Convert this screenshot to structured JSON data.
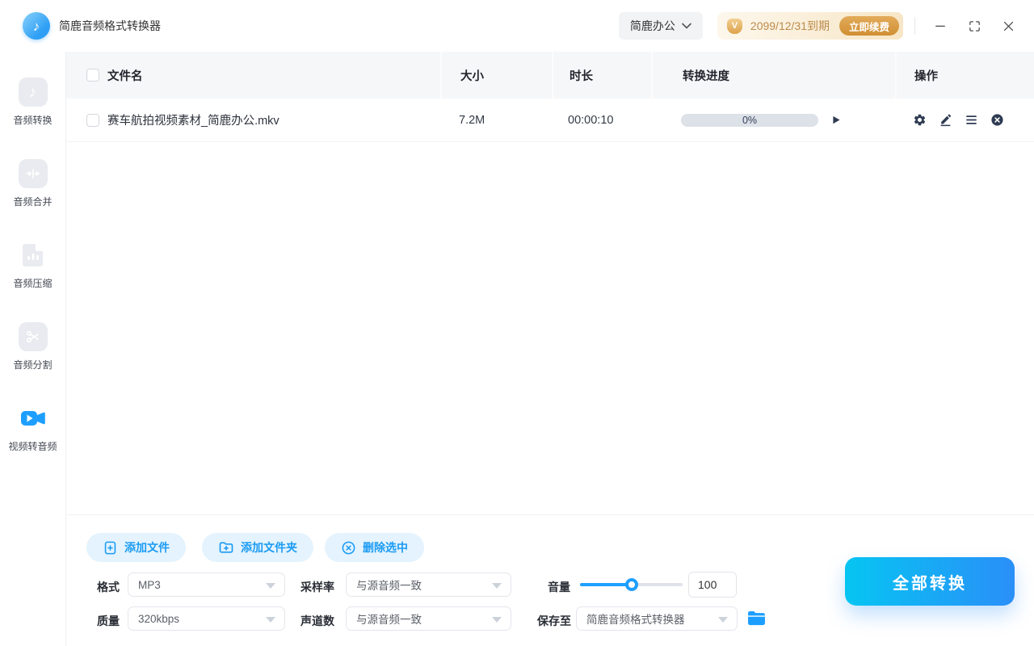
{
  "app": {
    "title": "简鹿音频格式转换器"
  },
  "topbar": {
    "account_dropdown_label": "简鹿办公",
    "vip_badge": "V",
    "license_expiry": "2099/12/31到期",
    "renew_button": "立即续费"
  },
  "sidebar": {
    "items": [
      {
        "label": "音频转换",
        "icon": "music-note-icon",
        "active": false
      },
      {
        "label": "音频合并",
        "icon": "merge-arrows-icon",
        "active": false
      },
      {
        "label": "音频压缩",
        "icon": "compress-file-icon",
        "active": false
      },
      {
        "label": "音频分割",
        "icon": "scissors-icon",
        "active": false
      },
      {
        "label": "视频转音频",
        "icon": "video-camera-icon",
        "active": true
      }
    ]
  },
  "table": {
    "headers": [
      "文件名",
      "大小",
      "时长",
      "转换进度",
      "操作"
    ],
    "rows": [
      {
        "name": "赛车航拍视频素材_简鹿办公.mkv",
        "size": "7.2M",
        "duration": "00:00:10",
        "progress_label": "0%",
        "progress_percent": 0
      }
    ]
  },
  "footer": {
    "add_file": "添加文件",
    "add_folder": "添加文件夹",
    "delete_selected": "删除选中",
    "convert_all": "全部转换",
    "settings": {
      "format": {
        "label": "格式",
        "value": "MP3"
      },
      "sample_rate": {
        "label": "采样率",
        "value": "与源音频一致"
      },
      "volume": {
        "label": "音量",
        "value": "100",
        "percent": 50
      },
      "quality": {
        "label": "质量",
        "value": "320kbps"
      },
      "channels": {
        "label": "声道数",
        "value": "与源音频一致"
      },
      "save_to": {
        "label": "保存至",
        "value": "简鹿音频格式转换器"
      }
    }
  },
  "colors": {
    "primary": "#1E9FFF",
    "convert_gradient_start": "#06C5F2",
    "convert_gradient_end": "#2A8FF8",
    "light_blue_button_bg": "#E4F3FE",
    "license_text": "#BC8B4C",
    "renew_gradient_start": "#E3AB5B",
    "renew_gradient_end": "#D08F33",
    "row_icon_dark": "#2F3B52",
    "progress_track": "#DDE1E8",
    "table_header_bg": "#F6F7F9"
  }
}
